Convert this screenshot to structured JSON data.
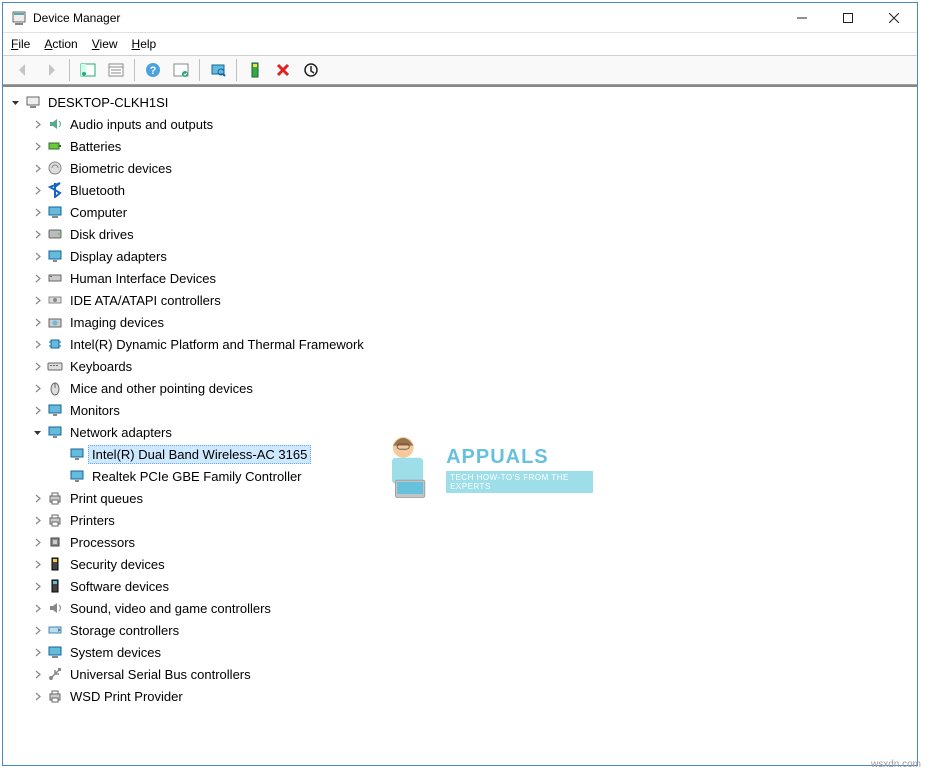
{
  "window": {
    "title": "Device Manager"
  },
  "menubar": {
    "file": "File",
    "action": "Action",
    "view": "View",
    "help": "Help"
  },
  "toolbar": {
    "back": "Back",
    "forward": "Forward",
    "show_hide": "Show/Hide Console Tree",
    "properties": "Properties",
    "help": "Help",
    "update": "Update Driver",
    "scan": "Scan for hardware changes",
    "add": "Add legacy hardware",
    "uninstall": "Uninstall device",
    "disable": "Disable device"
  },
  "tree": {
    "root": "DESKTOP-CLKH1SI",
    "categories": [
      {
        "label": "Audio inputs and outputs",
        "icon": "speaker",
        "expanded": false
      },
      {
        "label": "Batteries",
        "icon": "battery",
        "expanded": false
      },
      {
        "label": "Biometric devices",
        "icon": "fingerprint",
        "expanded": false
      },
      {
        "label": "Bluetooth",
        "icon": "bluetooth",
        "expanded": false
      },
      {
        "label": "Computer",
        "icon": "computer",
        "expanded": false
      },
      {
        "label": "Disk drives",
        "icon": "disk",
        "expanded": false
      },
      {
        "label": "Display adapters",
        "icon": "display",
        "expanded": false
      },
      {
        "label": "Human Interface Devices",
        "icon": "hid",
        "expanded": false
      },
      {
        "label": "IDE ATA/ATAPI controllers",
        "icon": "ide",
        "expanded": false
      },
      {
        "label": "Imaging devices",
        "icon": "camera",
        "expanded": false
      },
      {
        "label": "Intel(R) Dynamic Platform and Thermal Framework",
        "icon": "chip",
        "expanded": false
      },
      {
        "label": "Keyboards",
        "icon": "keyboard",
        "expanded": false
      },
      {
        "label": "Mice and other pointing devices",
        "icon": "mouse",
        "expanded": false
      },
      {
        "label": "Monitors",
        "icon": "monitor",
        "expanded": false
      },
      {
        "label": "Network adapters",
        "icon": "network",
        "expanded": true,
        "children": [
          {
            "label": "Intel(R) Dual Band Wireless-AC 3165",
            "icon": "network",
            "selected": true
          },
          {
            "label": "Realtek PCIe GBE Family Controller",
            "icon": "network",
            "selected": false
          }
        ]
      },
      {
        "label": "Print queues",
        "icon": "printer",
        "expanded": false
      },
      {
        "label": "Printers",
        "icon": "printer",
        "expanded": false
      },
      {
        "label": "Processors",
        "icon": "cpu",
        "expanded": false
      },
      {
        "label": "Security devices",
        "icon": "security",
        "expanded": false
      },
      {
        "label": "Software devices",
        "icon": "software",
        "expanded": false
      },
      {
        "label": "Sound, video and game controllers",
        "icon": "sound",
        "expanded": false
      },
      {
        "label": "Storage controllers",
        "icon": "storage",
        "expanded": false
      },
      {
        "label": "System devices",
        "icon": "system",
        "expanded": false
      },
      {
        "label": "Universal Serial Bus controllers",
        "icon": "usb",
        "expanded": false
      },
      {
        "label": "WSD Print Provider",
        "icon": "printer",
        "expanded": false
      }
    ]
  },
  "watermark": {
    "title": "APPUALS",
    "subtitle": "TECH HOW-TO'S FROM THE EXPERTS"
  },
  "credit": "wsxdn.com"
}
